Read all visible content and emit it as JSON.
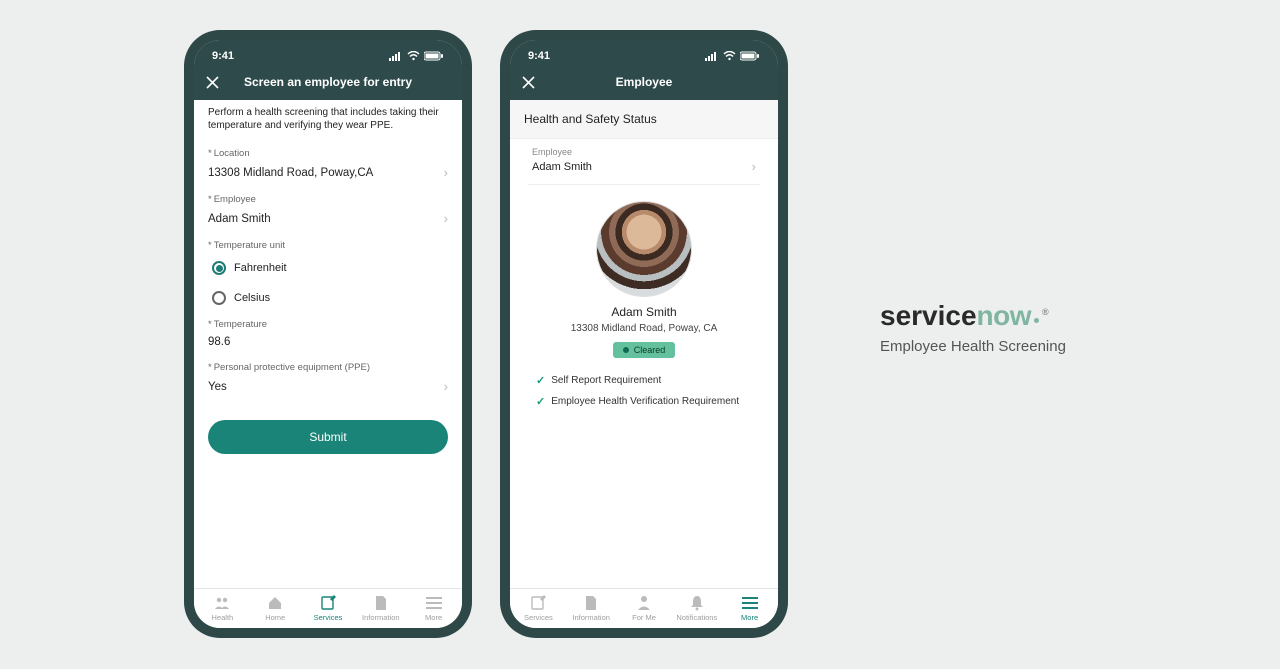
{
  "statusbar": {
    "time": "9:41"
  },
  "phone1": {
    "title": "Screen an employee for entry",
    "description": "Perform a health screening that includes taking their temperature and verifying they wear PPE.",
    "location_label": "Location",
    "location_value": "13308 Midland Road, Poway,CA",
    "employee_label": "Employee",
    "employee_value": "Adam Smith",
    "temp_unit_label": "Temperature unit",
    "unit_fahrenheit": "Fahrenheit",
    "unit_celsius": "Celsius",
    "temperature_label": "Temperature",
    "temperature_value": "98.6",
    "ppe_label": "Personal protective equipment (PPE)",
    "ppe_value": "Yes",
    "submit_label": "Submit",
    "tabs": {
      "health": "Health",
      "home": "Home",
      "services": "Services",
      "information": "Information",
      "more": "More"
    }
  },
  "phone2": {
    "title": "Employee",
    "card_title": "Health and Safety Status",
    "employee_label": "Employee",
    "employee_value": "Adam Smith",
    "name": "Adam Smith",
    "address": "13308 Midland Road, Poway, CA",
    "badge": "Cleared",
    "req1": "Self Report Requirement",
    "req2": "Employee Health Verification Requirement",
    "tabs": {
      "services": "Services",
      "information": "Information",
      "forme": "For Me",
      "notifications": "Notifications",
      "more": "More"
    }
  },
  "brand": {
    "service": "service",
    "now": "now",
    "sub": "Employee Health Screening"
  }
}
